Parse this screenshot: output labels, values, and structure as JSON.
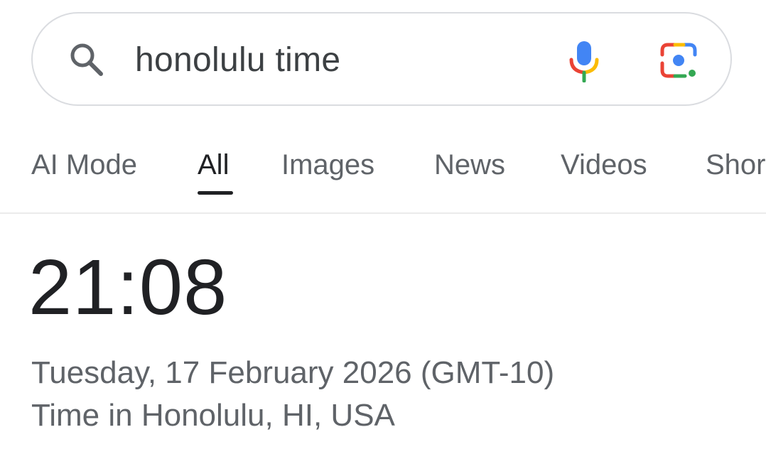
{
  "search": {
    "query": "honolulu time",
    "left_icon": "search-icon",
    "right_icons": [
      "microphone-icon",
      "google-lens-icon"
    ]
  },
  "tabs": [
    {
      "label": "AI Mode",
      "active": false
    },
    {
      "label": "All",
      "active": true
    },
    {
      "label": "Images",
      "active": false
    },
    {
      "label": "News",
      "active": false
    },
    {
      "label": "Videos",
      "active": false
    },
    {
      "label": "Shor",
      "active": false
    }
  ],
  "time_card": {
    "time": "21:08",
    "date": "Tuesday, 17 February 2026 (GMT-10)",
    "location": "Time in Honolulu, HI, USA"
  },
  "colors": {
    "google_blue": "#4285F4",
    "google_red": "#EA4335",
    "google_yellow": "#FBBC05",
    "google_green": "#34A853",
    "active_tab": "#202124",
    "inactive_tab": "#5f6368"
  }
}
